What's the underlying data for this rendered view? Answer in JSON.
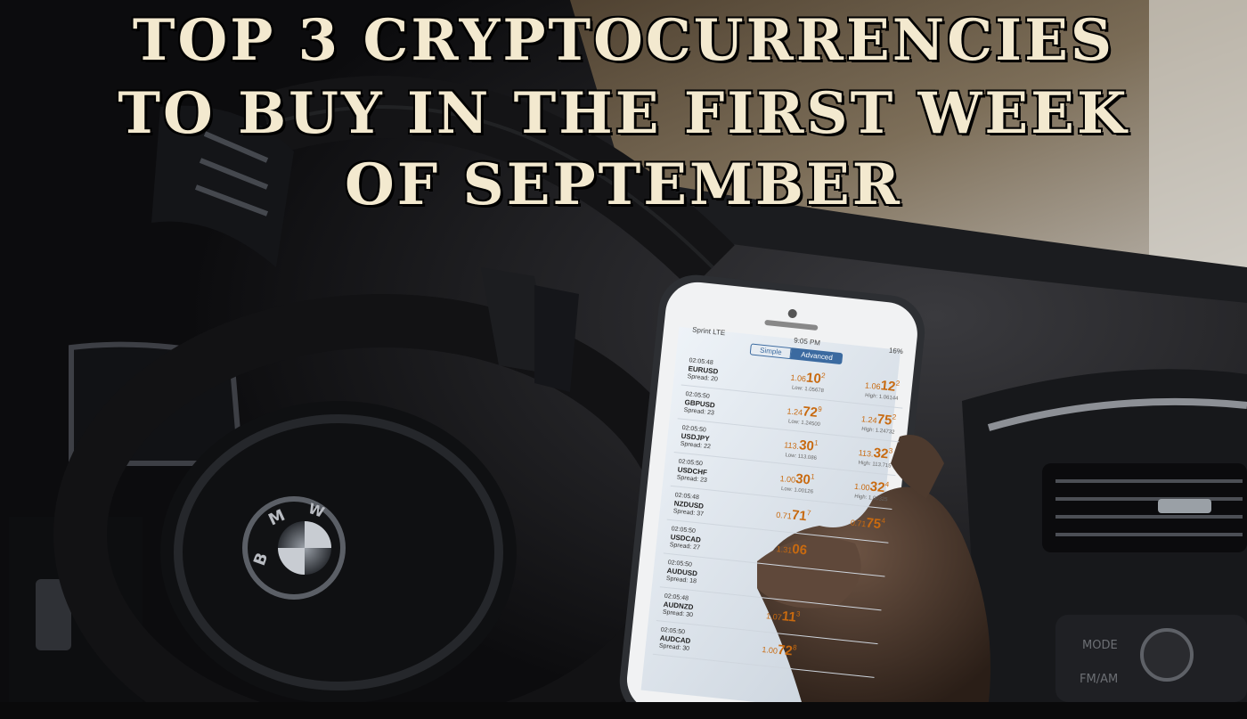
{
  "headline": {
    "line1": "TOP 3 CRYPTOCURRENCIES",
    "line2": "TO BUY IN THE FIRST WEEK",
    "line3": "OF SEPTEMBER"
  },
  "phone": {
    "carrier": "Sprint LTE",
    "time": "9:05 PM",
    "battery": "16%",
    "tabs": [
      "Simple",
      "Advanced"
    ],
    "quotes": [
      {
        "time": "02:05:48",
        "pair": "EURUSD",
        "spread": "Spread: 20",
        "bid_pre": "1.06",
        "bid_big": "10",
        "bid_sup": "2",
        "ask_pre": "1.06",
        "ask_big": "12",
        "ask_sup": "2",
        "low": "Low: 1.05678",
        "high": "High: 1.06144"
      },
      {
        "time": "02:05:50",
        "pair": "GBPUSD",
        "spread": "Spread: 23",
        "bid_pre": "1.24",
        "bid_big": "72",
        "bid_sup": "9",
        "ask_pre": "1.24",
        "ask_big": "75",
        "ask_sup": "2",
        "low": "Low: 1.24500",
        "high": "High: 1.24732"
      },
      {
        "time": "02:05:50",
        "pair": "USDJPY",
        "spread": "Spread: 22",
        "bid_pre": "113.",
        "bid_big": "30",
        "bid_sup": "1",
        "ask_pre": "113.",
        "ask_big": "32",
        "ask_sup": "3",
        "low": "Low: 113.086",
        "high": "High: 113.715"
      },
      {
        "time": "02:05:50",
        "pair": "USDCHF",
        "spread": "Spread: 23",
        "bid_pre": "1.00",
        "bid_big": "30",
        "bid_sup": "1",
        "ask_pre": "1.00",
        "ask_big": "32",
        "ask_sup": "4",
        "low": "Low: 1.00126",
        "high": "High: 1.00325"
      },
      {
        "time": "02:05:48",
        "pair": "NZDUSD",
        "spread": "Spread: 37",
        "bid_pre": "0.71",
        "bid_big": "71",
        "bid_sup": "7",
        "ask_pre": "0.71",
        "ask_big": "75",
        "ask_sup": "4",
        "low": "",
        "high": ""
      },
      {
        "time": "02:05:50",
        "pair": "USDCAD",
        "spread": "Spread: 27",
        "bid_pre": "1.31",
        "bid_big": "06",
        "bid_sup": "",
        "ask_pre": "",
        "ask_big": "",
        "ask_sup": "",
        "low": "",
        "high": ""
      },
      {
        "time": "02:05:50",
        "pair": "AUDUSD",
        "spread": "Spread: 18",
        "bid_pre": "",
        "bid_big": "",
        "bid_sup": "",
        "ask_pre": "",
        "ask_big": "",
        "ask_sup": "",
        "low": "",
        "high": ""
      },
      {
        "time": "02:05:48",
        "pair": "AUDNZD",
        "spread": "Spread: 30",
        "bid_pre": "1.07",
        "bid_big": "11",
        "bid_sup": "3",
        "ask_pre": "",
        "ask_big": "",
        "ask_sup": "",
        "low": "",
        "high": ""
      },
      {
        "time": "02:05:50",
        "pair": "AUDCAD",
        "spread": "Spread: 30",
        "bid_pre": "1.00",
        "bid_big": "72",
        "bid_sup": "8",
        "ask_pre": "",
        "ask_big": "",
        "ask_sup": "",
        "low": "",
        "high": ""
      }
    ]
  },
  "car": {
    "logo_letters": [
      "B",
      "M",
      "W"
    ],
    "console_labels": [
      "MODE",
      "FM/AM"
    ]
  },
  "colors": {
    "title_fill": "#f3e9cf",
    "quote_orange": "#c86a10",
    "screen": "#dfe7ef"
  }
}
